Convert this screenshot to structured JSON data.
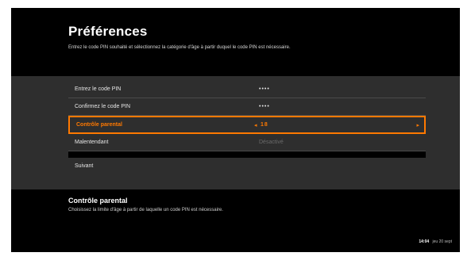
{
  "header": {
    "title": "Préférences",
    "subtitle": "Entrez le code PIN souhaité et sélectionnez la catégorie d'âge à partir duquel le code PIN est nécessaire."
  },
  "menu": {
    "rows": [
      {
        "label": "Entrez le code PIN",
        "value": "••••"
      },
      {
        "label": "Confirmez le code PIN",
        "value": "••••"
      },
      {
        "label": "Contrôle parental",
        "value": "18"
      },
      {
        "label": "Malentendant",
        "value": "Désactivé"
      }
    ],
    "next_label": "Suivant",
    "arrow_left": "◂",
    "arrow_right": "▸"
  },
  "info": {
    "title": "Contrôle parental",
    "text": "Choisissez la limite d'âge à partir de laquelle un code PIN est nécessaire."
  },
  "status": {
    "time": "14:04",
    "date": "jeu 20 sept"
  },
  "colors": {
    "accent": "#ff7900",
    "band": "#2e2e2e"
  }
}
